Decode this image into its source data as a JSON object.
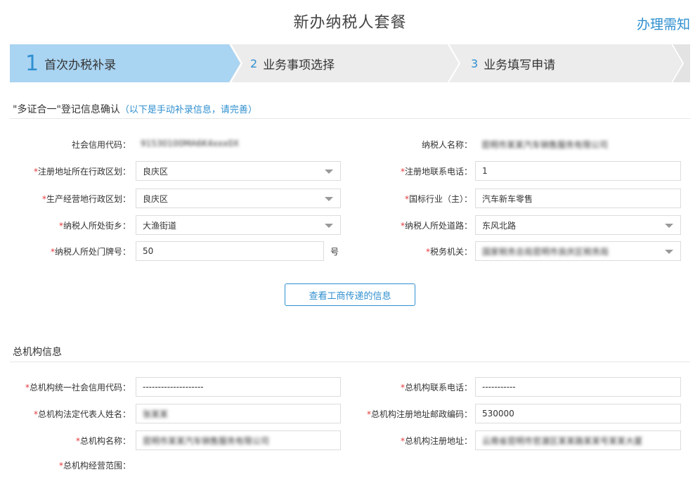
{
  "header": {
    "title": "新办纳税人套餐",
    "guide_link": "办理需知"
  },
  "steps": [
    {
      "num": "1",
      "label": "首次办税补录",
      "active": true
    },
    {
      "num": "2",
      "label": "业务事项选择",
      "active": false
    },
    {
      "num": "3",
      "label": "业务填写申请",
      "active": false
    }
  ],
  "section1": {
    "title": "\"多证合一\"登记信息确认",
    "hint": "（以下是手动补录信息，请完善）"
  },
  "fields": {
    "credit_code": {
      "label": "社会信用代码：",
      "value": "91530100MA6K4xxx0X"
    },
    "taxpayer_name": {
      "label": "纳税人名称：",
      "value": "昆明市某某汽车销售服务有限公司"
    },
    "reg_district": {
      "label": "注册地址所在行政区划：",
      "value": "良庆区"
    },
    "reg_phone": {
      "label": "注册地联系电话：",
      "value": "1"
    },
    "biz_district": {
      "label": "生产经营地行政区划：",
      "value": "良庆区"
    },
    "industry": {
      "label": "国标行业（主）：",
      "value": "汽车新车零售"
    },
    "street": {
      "label": "纳税人所处街乡：",
      "value": "大渔街道"
    },
    "road": {
      "label": "纳税人所处道路：",
      "value": "东风北路"
    },
    "door_no": {
      "label": "纳税人所处门牌号：",
      "value": "50",
      "unit": "号"
    },
    "tax_office": {
      "label": "税务机关：",
      "value": "国家税务总局昆明市良庆区税务局"
    }
  },
  "view_button": "查看工商传递的信息",
  "section2": {
    "title": "总机构信息"
  },
  "hq": {
    "credit_code": {
      "label": "总机构统一社会信用代码：",
      "value": "--------------------"
    },
    "phone": {
      "label": "总机构联系电话：",
      "value": "-----------"
    },
    "legal_rep": {
      "label": "总机构法定代表人姓名：",
      "value": "张某某"
    },
    "postcode": {
      "label": "总机构注册地址邮政编码：",
      "value": "530000"
    },
    "name": {
      "label": "总机构名称：",
      "value": "昆明市某某汽车销售服务有限公司"
    },
    "address": {
      "label": "总机构注册地址：",
      "value": "云南省昆明市官渡区某某路某某号某某大厦"
    },
    "scope": {
      "label": "总机构经营范围："
    }
  },
  "required_mark": "*"
}
